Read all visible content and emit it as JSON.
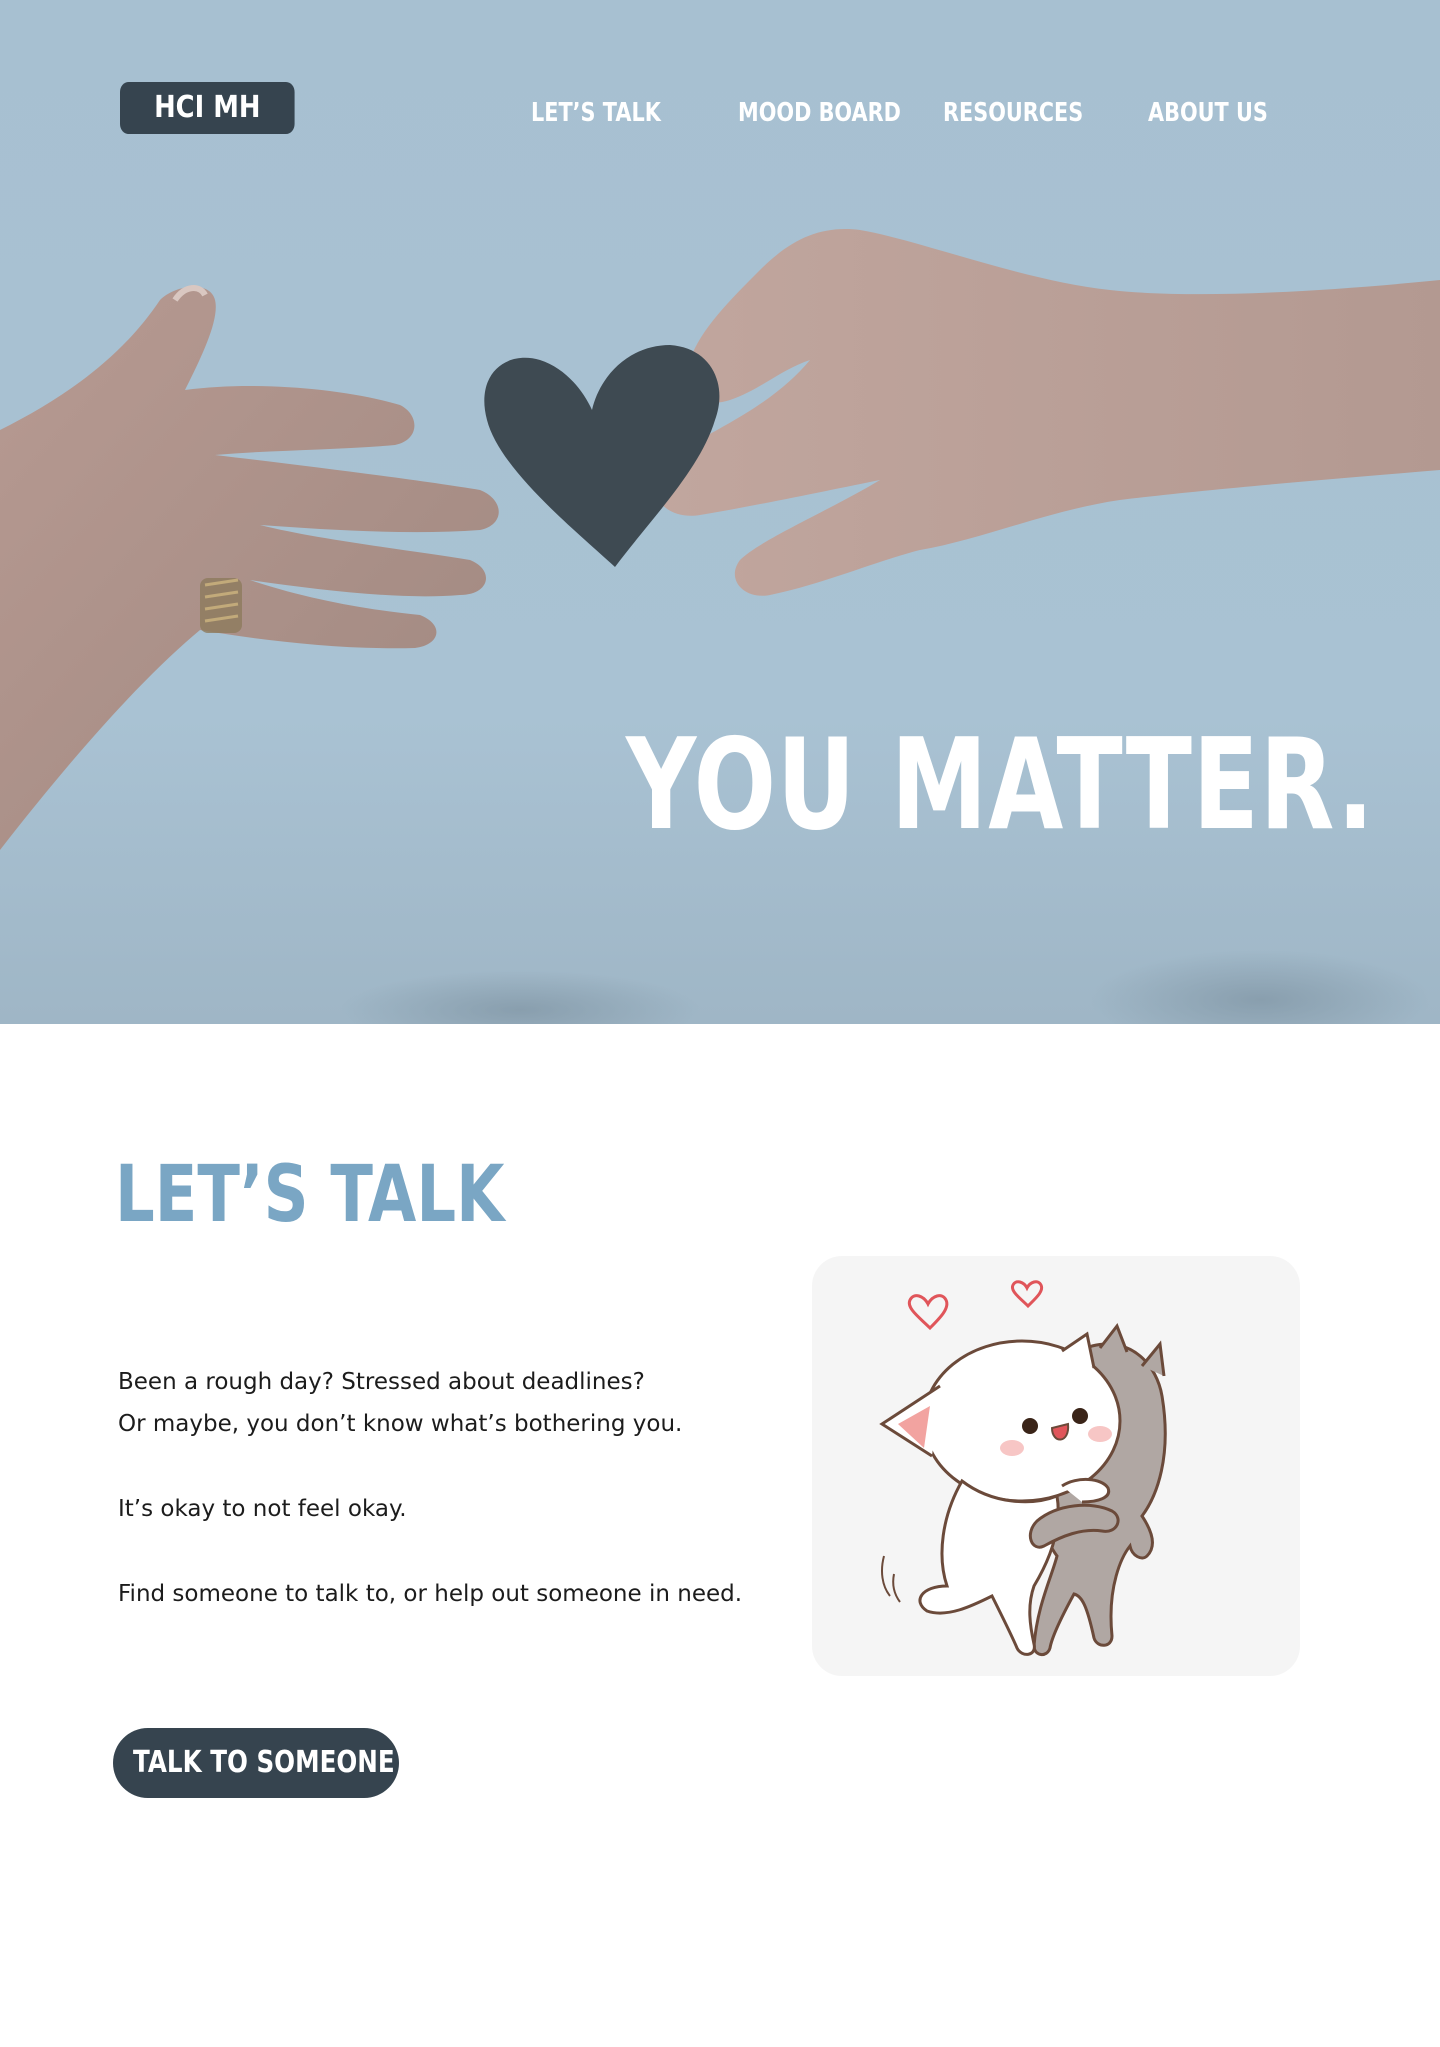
{
  "nav": {
    "logo": "HCI MH",
    "items": [
      {
        "label": "LET’S TALK"
      },
      {
        "label": "MOOD BOARD"
      },
      {
        "label": "RESOURCES"
      },
      {
        "label": "ABOUT US"
      }
    ]
  },
  "hero": {
    "headline": "YOU MATTER.",
    "image_description_icon": "hands-heart-image"
  },
  "lets_talk": {
    "title": "LET’S TALK",
    "lines": [
      "Been a rough day? Stressed about deadlines?",
      "Or maybe, you don’t know what’s bothering you.",
      "It’s okay to not feel okay.",
      "Find someone to talk to, or help out someone in need."
    ],
    "cta_label": "TALK TO SOMEONE",
    "illustration_icon": "hugging-cats-illustration"
  },
  "colors": {
    "hero_bg": "#a8c1d2",
    "dark": "#36444f",
    "accent": "#7aa6c4",
    "card_bg": "#f5f5f5"
  }
}
